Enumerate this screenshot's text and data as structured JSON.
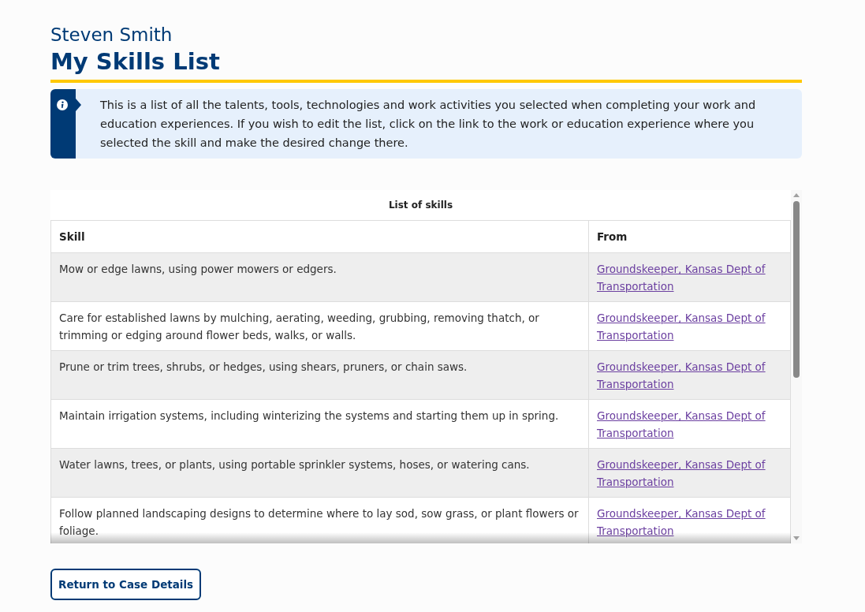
{
  "header": {
    "name": "Steven Smith",
    "title": "My Skills List"
  },
  "info": {
    "text": "This is a list of all the talents, tools, technologies and work activities you selected when completing your work and education experiences. If you wish to edit the list, click on the link to the work or education experience where you selected the skill and make the desired change there."
  },
  "table": {
    "caption": "List of skills",
    "columns": [
      "Skill",
      "From"
    ],
    "rows": [
      {
        "skill": "Mow or edge lawns, using power mowers or edgers.",
        "from": "Groundskeeper, Kansas Dept of Transportation"
      },
      {
        "skill": "Care for established lawns by mulching, aerating, weeding, grubbing, removing thatch, or trimming or edging around flower beds, walks, or walls.",
        "from": "Groundskeeper, Kansas Dept of Transportation"
      },
      {
        "skill": "Prune or trim trees, shrubs, or hedges, using shears, pruners, or chain saws.",
        "from": "Groundskeeper, Kansas Dept of Transportation"
      },
      {
        "skill": "Maintain irrigation systems, including winterizing the systems and starting them up in spring.",
        "from": "Groundskeeper, Kansas Dept of Transportation"
      },
      {
        "skill": "Water lawns, trees, or plants, using portable sprinkler systems, hoses, or watering cans.",
        "from": "Groundskeeper, Kansas Dept of Transportation"
      },
      {
        "skill": "Follow planned landscaping designs to determine where to lay sod, sow grass, or plant flowers or foliage.",
        "from": "Groundskeeper, Kansas Dept of Transportation"
      }
    ]
  },
  "buttons": [
    "Return to Case Details"
  ]
}
